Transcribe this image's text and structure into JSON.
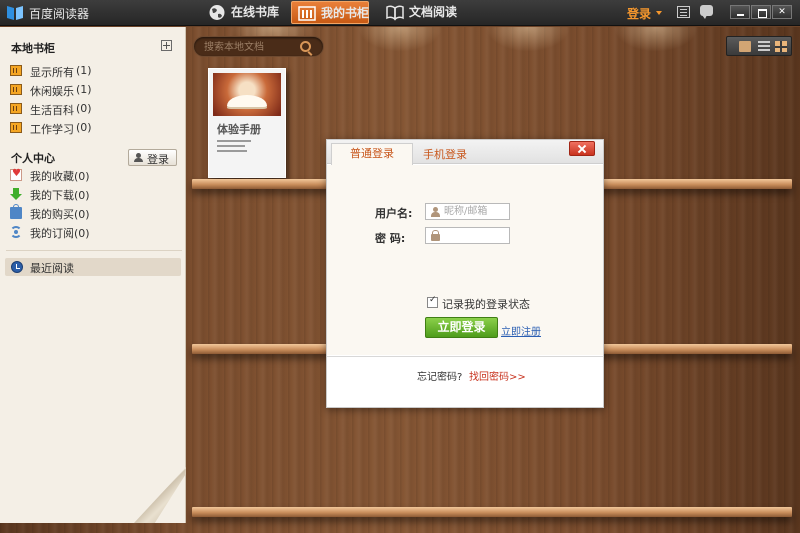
{
  "app": {
    "title": "百度阅读器"
  },
  "nav": {
    "online_store": "在线书库",
    "my_shelf": "我的书柜",
    "doc_reading": "文档阅读"
  },
  "top": {
    "login": "登录"
  },
  "search": {
    "placeholder": "搜索本地文档"
  },
  "sidebar": {
    "library_title": "本地书柜",
    "categories": [
      {
        "label": "显示所有",
        "count": "(1)"
      },
      {
        "label": "休闲娱乐",
        "count": "(1)"
      },
      {
        "label": "生活百科",
        "count": "(0)"
      },
      {
        "label": "工作学习",
        "count": "(0)"
      }
    ],
    "personal_title": "个人中心",
    "login_button": "登录",
    "personal_items": [
      {
        "label": "我的收藏",
        "count": "(0)"
      },
      {
        "label": "我的下载",
        "count": "(0)"
      },
      {
        "label": "我的购买",
        "count": "(0)"
      },
      {
        "label": "我的订阅",
        "count": "(0)"
      }
    ],
    "recent": "最近阅读"
  },
  "book": {
    "title": "体验手册"
  },
  "dialog": {
    "tab_normal": "普通登录",
    "tab_phone": "手机登录",
    "username_label": "用户名:",
    "username_placeholder": "昵称/邮箱",
    "password_label": "密  码:",
    "remember": "记录我的登录状态",
    "submit": "立即登录",
    "register": "立即注册",
    "forgot_label": "忘记密码?",
    "forgot_link": "找回密码>>"
  },
  "colors": {
    "accent_orange": "#c85a14",
    "login_text": "#f5972d",
    "submit_green": "#5aa822",
    "link_blue": "#2b5fb3",
    "wood": "#7d4f2f"
  }
}
